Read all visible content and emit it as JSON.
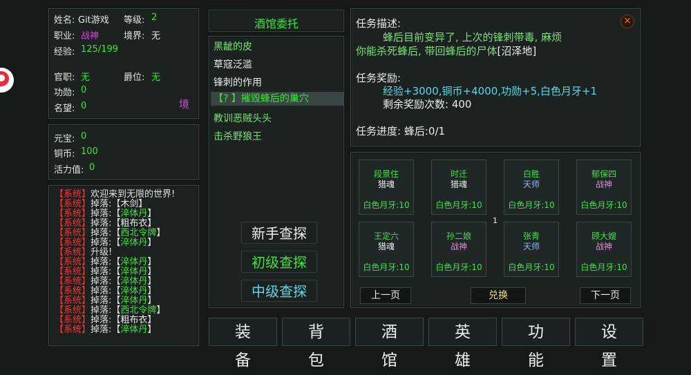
{
  "profile": {
    "name_label": "姓名:",
    "name": "Git游戏",
    "level_label": "等级:",
    "level": "2",
    "job_label": "职业:",
    "job": "战神",
    "realm_label": "境界:",
    "realm": "无",
    "exp_label": "经验:",
    "exp": "125/199",
    "office_label": "官职:",
    "office": "无",
    "peerage_label": "爵位:",
    "peerage": "无",
    "merit_label": "功勋:",
    "merit": "0",
    "fame_label": "名望:",
    "fame": "0",
    "realm_button": "境"
  },
  "currency": {
    "yuanbao_label": "元宝:",
    "yuanbao": "0",
    "copper_label": "铜币:",
    "copper": "100",
    "vitality_label": "活力值:",
    "vitality": "0"
  },
  "log": [
    {
      "tag": "【系统】",
      "pre": "欢迎来到无限的世界!",
      "item": "",
      "item_color": ""
    },
    {
      "tag": "【系统】",
      "pre": "掉落:【",
      "item": "木剑",
      "post": "】",
      "item_color": "white"
    },
    {
      "tag": "【系统】",
      "pre": "掉落:【",
      "item": "淬体丹",
      "post": "】",
      "item_color": "green"
    },
    {
      "tag": "【系统】",
      "pre": "掉落:【",
      "item": "粗布衣",
      "post": "】",
      "item_color": "white"
    },
    {
      "tag": "【系统】",
      "pre": "掉落:【",
      "item": "西北令牌",
      "post": "】",
      "item_color": "green"
    },
    {
      "tag": "【系统】",
      "pre": "掉落:【",
      "item": "淬体丹",
      "post": "】",
      "item_color": "green"
    },
    {
      "tag": "【系统】",
      "pre": "升级!",
      "item": "",
      "item_color": ""
    },
    {
      "tag": "【系统】",
      "pre": "掉落:【",
      "item": "淬体丹",
      "post": "】",
      "item_color": "green"
    },
    {
      "tag": "【系统】",
      "pre": "掉落:【",
      "item": "淬体丹",
      "post": "】",
      "item_color": "green"
    },
    {
      "tag": "【系统】",
      "pre": "掉落:【",
      "item": "淬体丹",
      "post": "】",
      "item_color": "green"
    },
    {
      "tag": "【系统】",
      "pre": "掉落:【",
      "item": "淬体丹",
      "post": "】",
      "item_color": "green"
    },
    {
      "tag": "【系统】",
      "pre": "掉落:【",
      "item": "淬体丹",
      "post": "】",
      "item_color": "green"
    },
    {
      "tag": "【系统】",
      "pre": "掉落:【",
      "item": "西北令牌",
      "post": "】",
      "item_color": "green"
    },
    {
      "tag": "【系统】",
      "pre": "掉落:【",
      "item": "粗布衣",
      "post": "】",
      "item_color": "white"
    },
    {
      "tag": "【系统】",
      "pre": "掉落:【",
      "item": "淬体丹",
      "post": "】",
      "item_color": "green"
    }
  ],
  "tavern": {
    "title": "酒馆委托",
    "quests": [
      {
        "label": "黑龇的皮",
        "color": "lightgreen"
      },
      {
        "label": "草寇泛滥",
        "color": "white"
      },
      {
        "label": "锋刺的作用",
        "color": "white"
      },
      {
        "label": "【? 】摧毁蜂后的巢穴",
        "color": "green"
      },
      {
        "label": "教训恶贼头头",
        "color": "lightgreen"
      },
      {
        "label": "击杀野狼王",
        "color": "lightgreen"
      }
    ],
    "explore_novice": "新手查探",
    "explore_basic": "初级查探",
    "explore_mid": "中级查探"
  },
  "quest_detail": {
    "desc_label": "任务描述:",
    "desc_line1": "蜂后目前变异了, 上次的锋刺带毒, 麻烦",
    "desc_line2": "你能杀死蜂后, 带回蜂后的尸体",
    "desc_place": "[沼泽地]",
    "reward_label": "任务奖励:",
    "reward_text": "经验+3000,铜币+4000,功勋+5,白色月牙+1",
    "remaining_label": "剩余奖励次数:",
    "remaining": "400",
    "progress_label": "任务进度:",
    "progress": "蜂后:0/1",
    "close_icon": "×"
  },
  "exchange": {
    "cards": [
      {
        "name": "段景住",
        "class": "猎魂",
        "class_color": "white",
        "reward": "白色月牙:10"
      },
      {
        "name": "时迁",
        "class": "猎魂",
        "class_color": "white",
        "reward": "白色月牙:10"
      },
      {
        "name": "白胜",
        "class": "天师",
        "class_color": "blueish",
        "reward": "白色月牙:10"
      },
      {
        "name": "郁保四",
        "class": "战神",
        "class_color": "pink",
        "reward": "白色月牙:10"
      },
      {
        "name": "王定六",
        "class": "猎魂",
        "class_color": "white",
        "reward": "白色月牙:10"
      },
      {
        "name": "孙二娘",
        "class": "战神",
        "class_color": "pink",
        "reward": "白色月牙:10"
      },
      {
        "name": "张青",
        "class": "天师",
        "class_color": "blueish",
        "reward": "白色月牙:10"
      },
      {
        "name": "顾大嫂",
        "class": "战神",
        "class_color": "pink",
        "reward": "白色月牙:10"
      }
    ],
    "page_number": "1",
    "prev_label": "上一页",
    "exchange_label": "兑换",
    "next_label": "下一页"
  },
  "bottom_tabs": [
    "装备",
    "背包",
    "酒馆",
    "英雄",
    "功能",
    "设置"
  ],
  "colors": {
    "green": "#39e639",
    "magenta": "#e23de2",
    "cyan": "#5ad8e8",
    "system_red": "#ff3030",
    "exchange_yellow": "#f0e060"
  }
}
